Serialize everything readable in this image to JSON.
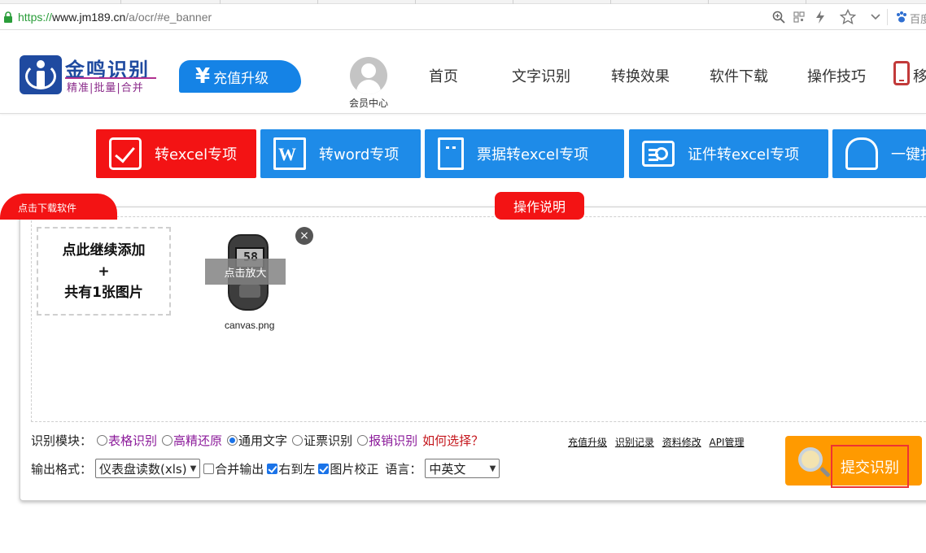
{
  "browser": {
    "url_scheme": "https://",
    "url_host": "www.jm189.cn",
    "url_path": "/a/ocr/#e_banner",
    "search_engine_label": "百度"
  },
  "header": {
    "logo_title": "金鸣识别",
    "logo_subtitle": "精准|批量|合并",
    "recharge_label": "充值升级",
    "recharge_symbol": "¥",
    "member_label": "会员中心",
    "nav": [
      "首页",
      "文字识别",
      "转换效果",
      "软件下载",
      "操作技巧"
    ],
    "nav_mobile_partial": "移"
  },
  "features": [
    {
      "label": "转excel专项",
      "color": "#f31314"
    },
    {
      "label": "转word专项",
      "color": "#1e8be8"
    },
    {
      "label": "票据转excel专项",
      "color": "#1e8be8"
    },
    {
      "label": "证件转excel专项",
      "color": "#1e8be8"
    },
    {
      "label": "一键拒",
      "color": "#1e8be8"
    }
  ],
  "panel": {
    "download_tab": "点击下载软件",
    "instructions": "操作说明",
    "add_more_line1": "点此继续添加",
    "add_more_line2": "+",
    "add_more_line3": "共有1张图片",
    "zoom_label": "点击放大",
    "remove_glyph": "×",
    "filename": "canvas.png"
  },
  "controls": {
    "module_label": "识别模块：",
    "modules": [
      {
        "label": "表格识别",
        "selected": false
      },
      {
        "label": "高精还原",
        "selected": false
      },
      {
        "label": "通用文字",
        "selected": true
      },
      {
        "label": "证票识别",
        "selected": false
      },
      {
        "label": "报销识别",
        "selected": false
      }
    ],
    "how_choose": "如何选择？",
    "output_label": "输出格式：",
    "output_value": "仪表盘读数(xls)",
    "merge_output": {
      "label": "合并输出",
      "checked": false
    },
    "right_to_left": {
      "label": "右到左",
      "checked": true
    },
    "image_correct": {
      "label": "图片校正",
      "checked": true
    },
    "language_label": "语言：",
    "language_value": "中英文",
    "links": [
      "充值升级",
      "识别记录",
      "资料修改",
      "API管理"
    ],
    "submit_label": "提交识别"
  },
  "colors": {
    "accent_red": "#f31314",
    "accent_blue": "#1e8be8",
    "submit_orange": "#ff9a00"
  }
}
